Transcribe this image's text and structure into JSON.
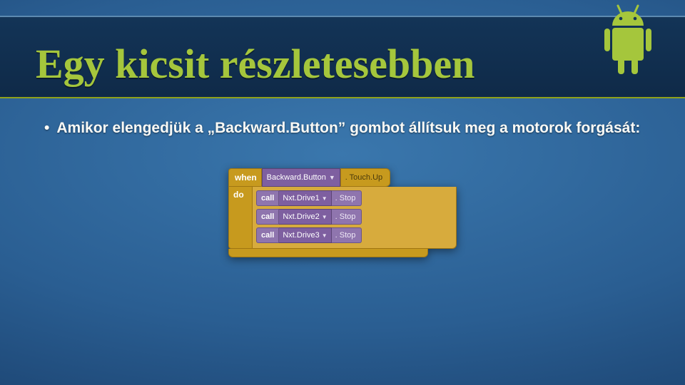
{
  "slide": {
    "title": "Egy kicsit részletesebben",
    "bullet": "Amikor elengedjük a „Backward.Button” gombot állítsuk meg a motorok forgását:"
  },
  "blocks": {
    "when_label": "when",
    "when_component": "Backward.Button",
    "when_event": ". Touch.Up",
    "do_label": "do",
    "call_label": "call",
    "calls": [
      {
        "component": "Nxt.Drive1",
        "method": ". Stop"
      },
      {
        "component": "Nxt.Drive2",
        "method": ". Stop"
      },
      {
        "component": "Nxt.Drive3",
        "method": ". Stop"
      }
    ]
  },
  "icons": {
    "android": "android-mascot"
  }
}
